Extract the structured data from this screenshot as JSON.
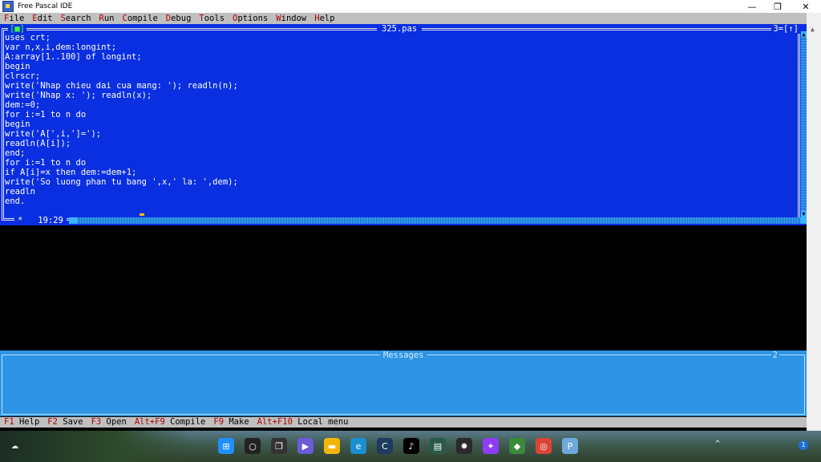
{
  "window": {
    "title": "Free Pascal IDE"
  },
  "menu": [
    {
      "hot": "F",
      "rest": "ile"
    },
    {
      "hot": "E",
      "rest": "dit"
    },
    {
      "hot": "S",
      "rest": "earch"
    },
    {
      "hot": "R",
      "rest": "un"
    },
    {
      "hot": "C",
      "rest": "ompile"
    },
    {
      "hot": "D",
      "rest": "ebug"
    },
    {
      "hot": "T",
      "rest": "ools"
    },
    {
      "hot": "O",
      "rest": "ptions"
    },
    {
      "hot": "W",
      "rest": "indow"
    },
    {
      "hot": "H",
      "rest": "elp"
    }
  ],
  "editor": {
    "filename": "325.pas",
    "close_box": "[■]",
    "window_number": "3=[↑]",
    "position": "19:29",
    "modified_marker": "*",
    "lines": [
      "uses crt;",
      "var n,x,i,dem:longint;",
      "A:array[1..100] of longint;",
      "begin",
      "clrscr;",
      "write('Nhap chieu dai cua mang: '); readln(n);",
      "write('Nhap x: '); readln(x);",
      "dem:=0;",
      "for i:=1 to n do",
      "begin",
      "write('A[',i,']=');",
      "readln(A[i]);",
      "end;",
      "for i:=1 to n do",
      "if A[i]=x then dem:=dem+1;",
      "write('So luong phan tu bang ',x,' la: ',dem);",
      "readln",
      "end."
    ]
  },
  "messages": {
    "title": "Messages",
    "number": "2"
  },
  "statusline": [
    {
      "key": "F1",
      "label": "Help"
    },
    {
      "key": "F2",
      "label": "Save"
    },
    {
      "key": "F3",
      "label": "Open"
    },
    {
      "key": "Alt+F9",
      "label": "Compile"
    },
    {
      "key": "F9",
      "label": "Make"
    },
    {
      "key": "Alt+F10",
      "label": "Local menu"
    }
  ],
  "taskbar": {
    "icons": [
      {
        "name": "start-icon",
        "glyph": "⊞",
        "color": "#1e90ff"
      },
      {
        "name": "search-icon",
        "glyph": "○",
        "color": "#222222"
      },
      {
        "name": "task-view-icon",
        "glyph": "❐",
        "color": "#333333"
      },
      {
        "name": "meet-icon",
        "glyph": "▶",
        "color": "#6b5bd6"
      },
      {
        "name": "file-explorer-icon",
        "glyph": "▬",
        "color": "#f2b600"
      },
      {
        "name": "edge-icon",
        "glyph": "e",
        "color": "#1a8fd0"
      },
      {
        "name": "app-c-icon",
        "glyph": "C",
        "color": "#1d3b5e"
      },
      {
        "name": "tiktok-icon",
        "glyph": "♪",
        "color": "#000000"
      },
      {
        "name": "app-green-icon",
        "glyph": "▤",
        "color": "#2a5a4a"
      },
      {
        "name": "app-red-icon",
        "glyph": "✹",
        "color": "#2a2a2a"
      },
      {
        "name": "messenger-icon",
        "glyph": "✦",
        "color": "#8e3cf7"
      },
      {
        "name": "app-globe-icon",
        "glyph": "◆",
        "color": "#3a8a3a"
      },
      {
        "name": "chrome-icon",
        "glyph": "◎",
        "color": "#db4437"
      },
      {
        "name": "free-pascal-icon",
        "glyph": "P",
        "color": "#6fa8dc"
      }
    ],
    "notification_count": "1"
  }
}
